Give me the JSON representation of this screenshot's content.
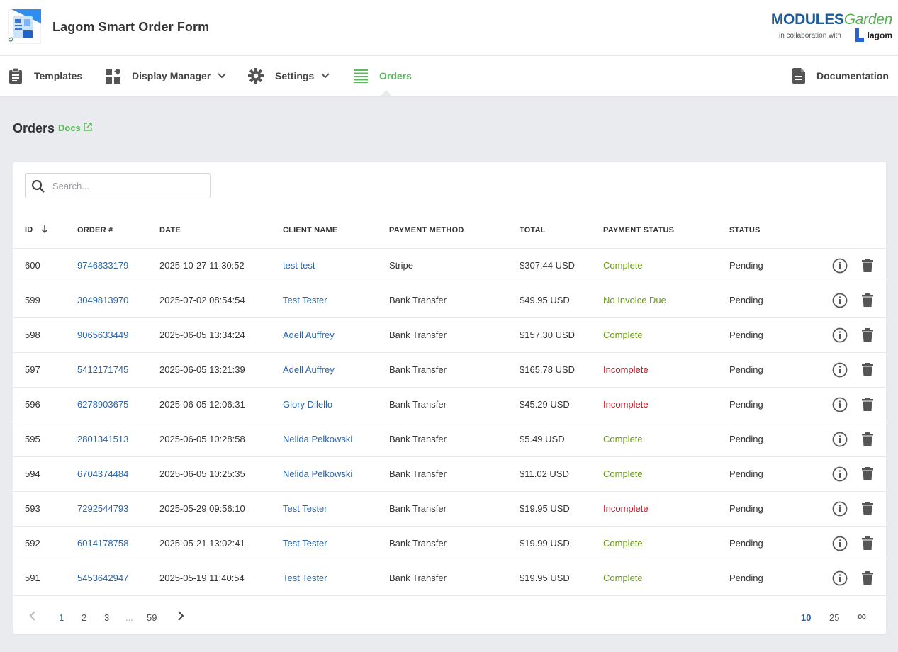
{
  "header": {
    "app_title": "Lagom Smart Order Form",
    "brand_modules": "MODULES",
    "brand_garden": "Garden",
    "brand_collab": "in collaboration with",
    "brand_lagom": "lagom"
  },
  "nav": {
    "items": [
      {
        "label": "Templates",
        "icon": "clipboard-icon"
      },
      {
        "label": "Display Manager",
        "icon": "dashboard-icon",
        "dropdown": true
      },
      {
        "label": "Settings",
        "icon": "gear-icon",
        "dropdown": true
      },
      {
        "label": "Orders",
        "icon": "list-icon",
        "active": true
      }
    ],
    "documentation": "Documentation"
  },
  "page": {
    "title": "Orders",
    "docs_link": "Docs"
  },
  "search": {
    "placeholder": "Search...",
    "value": ""
  },
  "table": {
    "columns": [
      "ID",
      "ORDER #",
      "DATE",
      "CLIENT NAME",
      "PAYMENT METHOD",
      "TOTAL",
      "PAYMENT STATUS",
      "STATUS"
    ],
    "rows": [
      {
        "id": "600",
        "order": "9746833179",
        "date": "2025-10-27 11:30:52",
        "client": "test test",
        "method": "Stripe",
        "total": "$307.44 USD",
        "payment_status": "Complete",
        "status": "Pending"
      },
      {
        "id": "599",
        "order": "3049813970",
        "date": "2025-07-02 08:54:54",
        "client": "Test Tester",
        "method": "Bank Transfer",
        "total": "$49.95 USD",
        "payment_status": "No Invoice Due",
        "status": "Pending"
      },
      {
        "id": "598",
        "order": "9065633449",
        "date": "2025-06-05 13:34:24",
        "client": "Adell Auffrey",
        "method": "Bank Transfer",
        "total": "$157.30 USD",
        "payment_status": "Complete",
        "status": "Pending"
      },
      {
        "id": "597",
        "order": "5412171745",
        "date": "2025-06-05 13:21:39",
        "client": "Adell Auffrey",
        "method": "Bank Transfer",
        "total": "$165.78 USD",
        "payment_status": "Incomplete",
        "status": "Pending"
      },
      {
        "id": "596",
        "order": "6278903675",
        "date": "2025-06-05 12:06:31",
        "client": "Glory Dilello",
        "method": "Bank Transfer",
        "total": "$45.29 USD",
        "payment_status": "Incomplete",
        "status": "Pending"
      },
      {
        "id": "595",
        "order": "2801341513",
        "date": "2025-06-05 10:28:58",
        "client": "Nelida Pelkowski",
        "method": "Bank Transfer",
        "total": "$5.49 USD",
        "payment_status": "Complete",
        "status": "Pending"
      },
      {
        "id": "594",
        "order": "6704374484",
        "date": "2025-06-05 10:25:35",
        "client": "Nelida Pelkowski",
        "method": "Bank Transfer",
        "total": "$11.02 USD",
        "payment_status": "Complete",
        "status": "Pending"
      },
      {
        "id": "593",
        "order": "7292544793",
        "date": "2025-05-29 09:56:10",
        "client": "Test Tester",
        "method": "Bank Transfer",
        "total": "$19.95 USD",
        "payment_status": "Incomplete",
        "status": "Pending"
      },
      {
        "id": "592",
        "order": "6014178758",
        "date": "2025-05-21 13:02:41",
        "client": "Test Tester",
        "method": "Bank Transfer",
        "total": "$19.99 USD",
        "payment_status": "Complete",
        "status": "Pending"
      },
      {
        "id": "591",
        "order": "5453642947",
        "date": "2025-05-19 11:40:54",
        "client": "Test Tester",
        "method": "Bank Transfer",
        "total": "$19.95 USD",
        "payment_status": "Complete",
        "status": "Pending"
      }
    ]
  },
  "pagination": {
    "pages": [
      "1",
      "2",
      "3",
      "...",
      "59"
    ],
    "current": "1",
    "page_sizes": [
      "10",
      "25",
      "∞"
    ],
    "current_size": "10"
  },
  "colors": {
    "accent_green": "#5cb85c",
    "link_blue": "#2a64a8",
    "complete": "#6a9a15",
    "incomplete": "#c4111d"
  }
}
